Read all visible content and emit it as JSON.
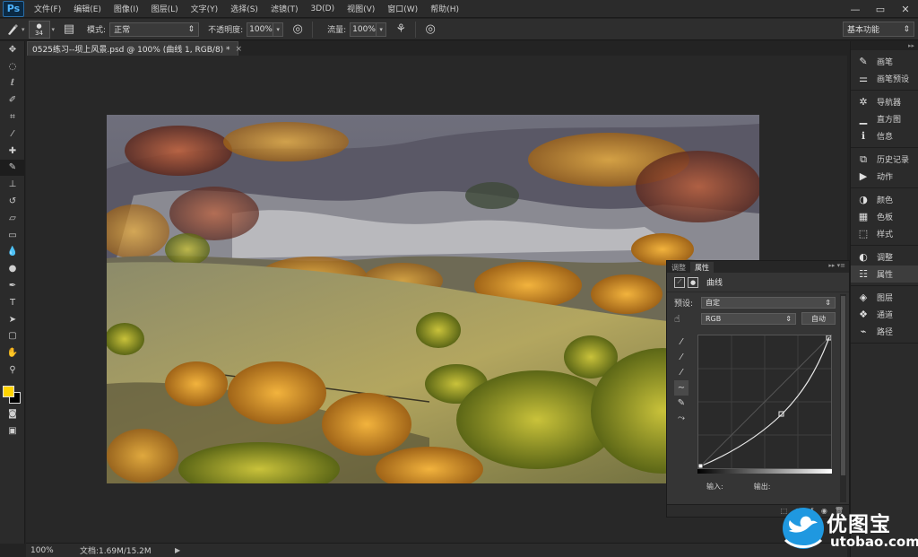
{
  "app": {
    "logo": "Ps"
  },
  "menu": [
    "文件(F)",
    "编辑(E)",
    "图像(I)",
    "图层(L)",
    "文字(Y)",
    "选择(S)",
    "滤镜(T)",
    "3D(D)",
    "视图(V)",
    "窗口(W)",
    "帮助(H)"
  ],
  "window_controls": [
    "—",
    "▭",
    "✕"
  ],
  "options": {
    "brush_size": "34",
    "mode_label": "模式:",
    "mode_value": "正常",
    "opacity_label": "不透明度:",
    "opacity_value": "100%",
    "flow_label": "流量:",
    "flow_value": "100%",
    "workspace": "基本功能"
  },
  "document": {
    "tab_title": "0525练习--坝上风景.psd @ 100% (曲线 1, RGB/8) *",
    "close": "×"
  },
  "status": {
    "zoom": "100%",
    "doc_info": "文档:1.69M/15.2M"
  },
  "dock": {
    "groups": [
      [
        {
          "icon": "brush-icon",
          "glyph": "✎",
          "label": "画笔"
        },
        {
          "icon": "brush-presets-icon",
          "glyph": "⚌",
          "label": "画笔预设"
        }
      ],
      [
        {
          "icon": "navigator-icon",
          "glyph": "✲",
          "label": "导航器"
        },
        {
          "icon": "histogram-icon",
          "glyph": "▁",
          "label": "直方图"
        },
        {
          "icon": "info-icon",
          "glyph": "ℹ",
          "label": "信息"
        }
      ],
      [
        {
          "icon": "history-icon",
          "glyph": "⧉",
          "label": "历史记录"
        },
        {
          "icon": "actions-icon",
          "glyph": "▶",
          "label": "动作"
        }
      ],
      [
        {
          "icon": "color-icon",
          "glyph": "◑",
          "label": "颜色"
        },
        {
          "icon": "swatches-icon",
          "glyph": "▦",
          "label": "色板"
        },
        {
          "icon": "styles-icon",
          "glyph": "⬚",
          "label": "样式"
        }
      ],
      [
        {
          "icon": "adjustments-icon",
          "glyph": "◐",
          "label": "调整"
        },
        {
          "icon": "properties-icon",
          "glyph": "☷",
          "label": "属性"
        }
      ],
      [
        {
          "icon": "layers-icon",
          "glyph": "◈",
          "label": "图层"
        },
        {
          "icon": "channels-icon",
          "glyph": "❖",
          "label": "通道"
        },
        {
          "icon": "paths-icon",
          "glyph": "⌁",
          "label": "路径"
        }
      ]
    ]
  },
  "properties": {
    "tabs": [
      "调整",
      "属性"
    ],
    "title": "曲线",
    "preset_label": "预设:",
    "preset_value": "自定",
    "channel_value": "RGB",
    "auto_button": "自动",
    "input_label": "输入:",
    "output_label": "输出:"
  },
  "watermark": {
    "name": "优图宝",
    "url": "utobao.com"
  }
}
